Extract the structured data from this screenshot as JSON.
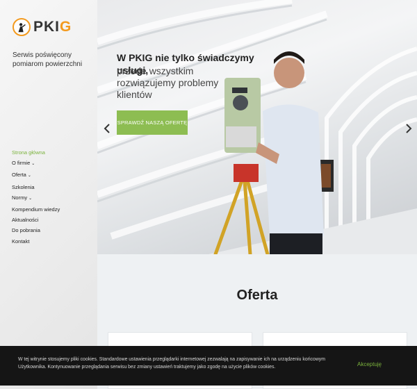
{
  "brand": {
    "logo_prefix": "PKI",
    "logo_suffix": "G",
    "tagline": "Serwis poświęcony pomiarom powierzchni",
    "accent_color": "#7bb33d",
    "logo_color": "#f39a1e"
  },
  "nav": {
    "items": [
      {
        "label": "Strona główna",
        "dropdown": false,
        "active": true
      },
      {
        "label": "O firmie",
        "dropdown": true,
        "active": false
      },
      {
        "label": "Oferta",
        "dropdown": true,
        "active": false
      },
      {
        "label": "Szkolenia",
        "dropdown": false,
        "active": false
      },
      {
        "label": "Normy",
        "dropdown": true,
        "active": false
      },
      {
        "label": "Kompendium wiedzy",
        "dropdown": false,
        "active": false
      },
      {
        "label": "Aktualności",
        "dropdown": false,
        "active": false
      },
      {
        "label": "Do pobrania",
        "dropdown": false,
        "active": false
      },
      {
        "label": "Kontakt",
        "dropdown": false,
        "active": false
      }
    ],
    "dropdown_icon": "chevron-down-icon"
  },
  "hero": {
    "title": "W PKIG nie tylko świadczymy usługi,",
    "subtitle": "przede wszystkim rozwiązujemy problemy klientów",
    "cta_label": "Sprawdź naszą ofertę",
    "prev_icon": "chevron-left-icon",
    "next_icon": "chevron-right-icon"
  },
  "offer": {
    "heading": "Oferta"
  },
  "cookie_bar": {
    "text": "W tej witrynie stosujemy pliki cookies. Standardowe ustawienia przeglądarki internetowej zezwalają na zapisywanie ich na urządzeniu końcowym Użytkownika. Kontynuowanie przeglądania serwisu bez zmiany ustawień traktujemy jako zgodę na użycie plików cookies.",
    "accept_label": "Akceptuję"
  }
}
